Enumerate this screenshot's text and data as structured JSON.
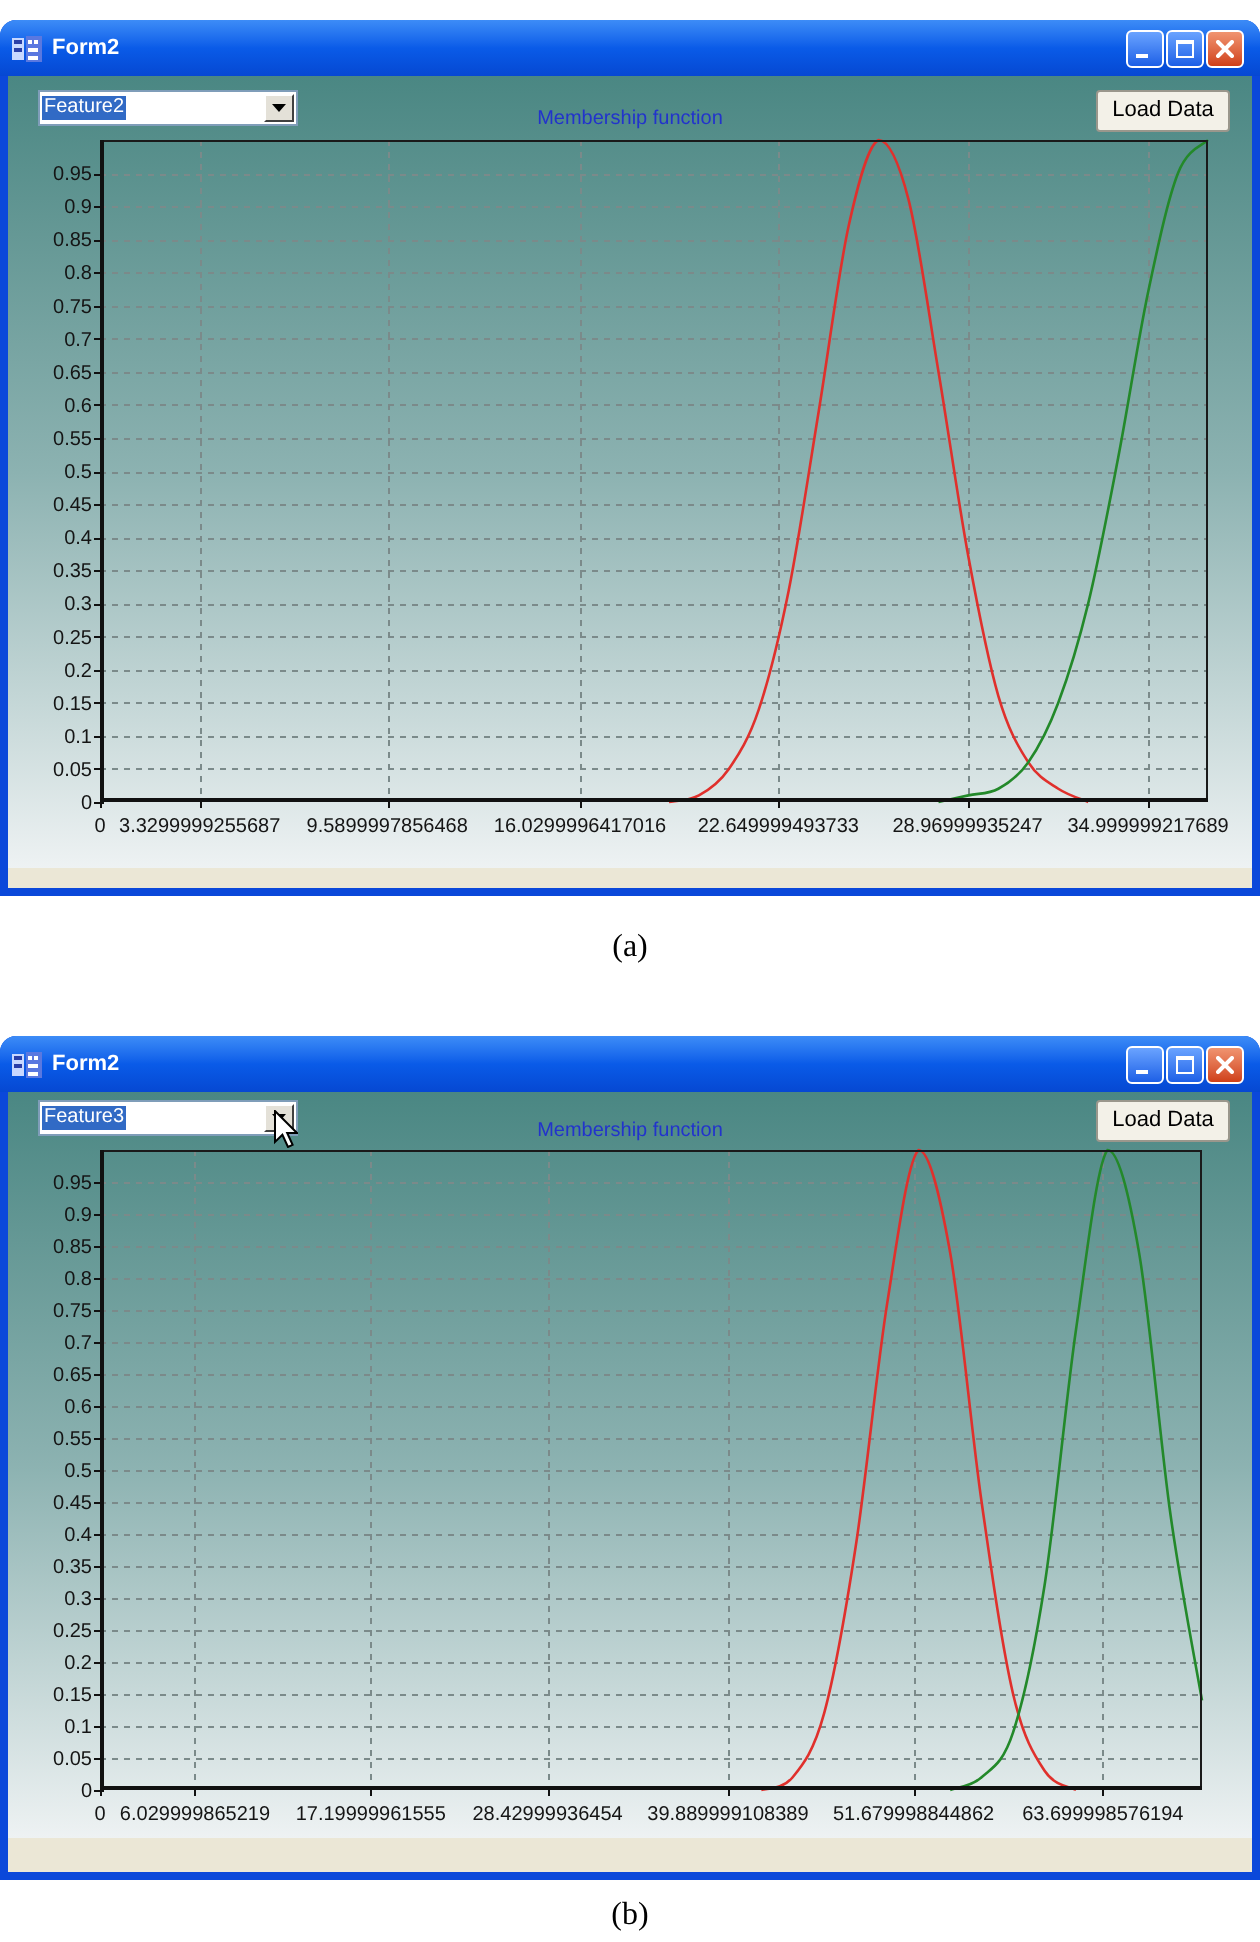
{
  "figures": [
    {
      "window": {
        "title": "Form2"
      },
      "dropdown": {
        "value": "Feature2",
        "text_selected": true,
        "hovered": false
      },
      "load_button": {
        "label": "Load Data"
      },
      "chart": {
        "chart_data": {
          "type": "line",
          "title": "Membership function",
          "x": [
            19,
            20,
            21,
            22,
            23,
            24,
            25,
            26,
            27,
            28,
            29,
            30,
            31,
            32,
            33,
            34,
            35,
            36,
            37
          ],
          "series": [
            {
              "color": "#e0302c",
              "values": [
                0,
                0.01,
                0.05,
                0.14,
                0.32,
                0.59,
                0.87,
                1,
                0.91,
                0.65,
                0.37,
                0.16,
                0.06,
                0.02,
                0,
                null,
                null,
                null,
                null
              ]
            },
            {
              "color": "#23892a",
              "values": [
                null,
                null,
                null,
                null,
                null,
                null,
                null,
                null,
                null,
                0,
                0.01,
                0.02,
                0.06,
                0.15,
                0.3,
                0.52,
                0.77,
                0.95,
                1
              ]
            }
          ],
          "xlim": [
            0,
            37
          ],
          "ylim": [
            0,
            1
          ],
          "xticks": [
            0,
            3.3299999255687,
            9.5899997856468,
            16.0299996417016,
            22.649999493733,
            28.96999935247,
            34.999999217689
          ],
          "yticks": [
            0,
            0.05,
            0.1,
            0.15,
            0.2,
            0.25,
            0.3,
            0.35,
            0.4,
            0.45,
            0.5,
            0.55,
            0.6,
            0.65,
            0.7,
            0.75,
            0.8,
            0.85,
            0.9,
            0.95
          ],
          "grid": true
        }
      },
      "caption": "(a)"
    },
    {
      "window": {
        "title": "Form2"
      },
      "dropdown": {
        "value": "Feature3",
        "text_selected": true,
        "hovered": true
      },
      "load_button": {
        "label": "Load Data"
      },
      "chart": {
        "chart_data": {
          "type": "line",
          "title": "Membership function",
          "x": [
            42,
            44,
            46,
            48,
            50,
            52,
            54,
            56,
            58,
            60,
            62,
            64,
            66,
            68,
            70
          ],
          "series": [
            {
              "color": "#e0302c",
              "values": [
                0,
                0.02,
                0.12,
                0.38,
                0.76,
                1,
                0.84,
                0.45,
                0.15,
                0.03,
                0,
                null,
                null,
                null,
                null
              ]
            },
            {
              "color": "#23892a",
              "values": [
                null,
                null,
                null,
                null,
                null,
                null,
                0,
                0.02,
                0.09,
                0.32,
                0.72,
                1,
                0.84,
                0.43,
                0.14
              ]
            }
          ],
          "xlim": [
            0,
            70
          ],
          "ylim": [
            0,
            1
          ],
          "xticks": [
            0,
            6.029999865219,
            17.19999961555,
            28.42999936454,
            39.889999108389,
            51.679998844862,
            63.699998576194
          ],
          "yticks": [
            0,
            0.05,
            0.1,
            0.15,
            0.2,
            0.25,
            0.3,
            0.35,
            0.4,
            0.45,
            0.5,
            0.55,
            0.6,
            0.65,
            0.7,
            0.75,
            0.8,
            0.85,
            0.9,
            0.95
          ],
          "grid": true
        }
      },
      "caption": "(b)"
    }
  ]
}
